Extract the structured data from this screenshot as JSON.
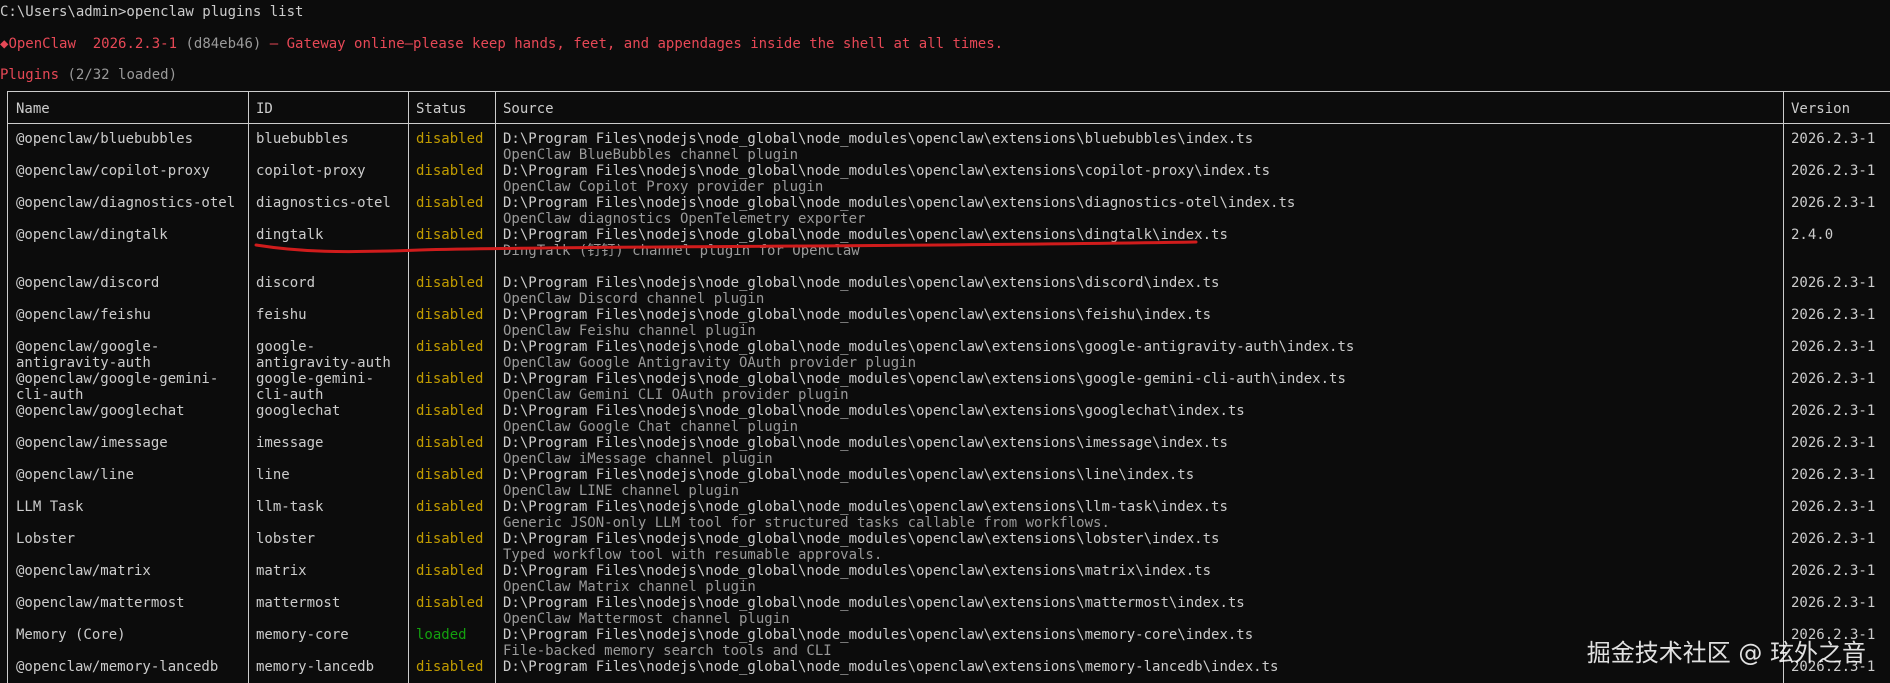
{
  "prompt": "C:\\Users\\admin>openclaw plugins list",
  "banner": {
    "icon": "◆",
    "name": "OpenClaw",
    "version": "2026.2.3-1",
    "hash": "(d84eb46)",
    "message": " — Gateway online—please keep hands, feet, and appendages inside the shell at all times."
  },
  "plugins_title": "Plugins",
  "plugins_count": "(2/32 loaded)",
  "columns": {
    "name": "Name",
    "id": "ID",
    "status": "Status",
    "source": "Source",
    "version": "Version"
  },
  "rows": [
    {
      "name": [
        "@openclaw/bluebubbles"
      ],
      "id": [
        "bluebubbles"
      ],
      "status": "disabled",
      "source": "D:\\Program Files\\nodejs\\node_global\\node_modules\\openclaw\\extensions\\bluebubbles\\index.ts",
      "desc": "OpenClaw BlueBubbles channel plugin",
      "version": "2026.2.3-1"
    },
    {
      "name": [
        "@openclaw/copilot-proxy"
      ],
      "id": [
        "copilot-proxy"
      ],
      "status": "disabled",
      "source": "D:\\Program Files\\nodejs\\node_global\\node_modules\\openclaw\\extensions\\copilot-proxy\\index.ts",
      "desc": "OpenClaw Copilot Proxy provider plugin",
      "version": "2026.2.3-1"
    },
    {
      "name": [
        "@openclaw/diagnostics-otel"
      ],
      "id": [
        "diagnostics-otel"
      ],
      "status": "disabled",
      "source": "D:\\Program Files\\nodejs\\node_global\\node_modules\\openclaw\\extensions\\diagnostics-otel\\index.ts",
      "desc": "OpenClaw diagnostics OpenTelemetry exporter",
      "version": "2026.2.3-1"
    },
    {
      "name": [
        "@openclaw/dingtalk"
      ],
      "id": [
        "dingtalk"
      ],
      "status": "disabled",
      "source": "D:\\Program Files\\nodejs\\node_global\\node_modules\\openclaw\\extensions\\dingtalk\\index.ts",
      "desc": "DingTalk (钉钉) channel plugin for OpenClaw",
      "version": "2.4.0"
    },
    {
      "name": [
        "@openclaw/discord"
      ],
      "id": [
        "discord"
      ],
      "status": "disabled",
      "source": "D:\\Program Files\\nodejs\\node_global\\node_modules\\openclaw\\extensions\\discord\\index.ts",
      "desc": "OpenClaw Discord channel plugin",
      "version": "2026.2.3-1"
    },
    {
      "name": [
        "@openclaw/feishu"
      ],
      "id": [
        "feishu"
      ],
      "status": "disabled",
      "source": "D:\\Program Files\\nodejs\\node_global\\node_modules\\openclaw\\extensions\\feishu\\index.ts",
      "desc": "OpenClaw Feishu channel plugin",
      "version": "2026.2.3-1"
    },
    {
      "name": [
        "@openclaw/google-",
        "antigravity-auth"
      ],
      "id": [
        "google-",
        "antigravity-auth"
      ],
      "status": "disabled",
      "source": "D:\\Program Files\\nodejs\\node_global\\node_modules\\openclaw\\extensions\\google-antigravity-auth\\index.ts",
      "desc": "OpenClaw Google Antigravity OAuth provider plugin",
      "version": "2026.2.3-1"
    },
    {
      "name": [
        "@openclaw/google-gemini-",
        "cli-auth"
      ],
      "id": [
        "google-gemini-",
        "cli-auth"
      ],
      "status": "disabled",
      "source": "D:\\Program Files\\nodejs\\node_global\\node_modules\\openclaw\\extensions\\google-gemini-cli-auth\\index.ts",
      "desc": "OpenClaw Gemini CLI OAuth provider plugin",
      "version": "2026.2.3-1"
    },
    {
      "name": [
        "@openclaw/googlechat"
      ],
      "id": [
        "googlechat"
      ],
      "status": "disabled",
      "source": "D:\\Program Files\\nodejs\\node_global\\node_modules\\openclaw\\extensions\\googlechat\\index.ts",
      "desc": "OpenClaw Google Chat channel plugin",
      "version": "2026.2.3-1"
    },
    {
      "name": [
        "@openclaw/imessage"
      ],
      "id": [
        "imessage"
      ],
      "status": "disabled",
      "source": "D:\\Program Files\\nodejs\\node_global\\node_modules\\openclaw\\extensions\\imessage\\index.ts",
      "desc": "OpenClaw iMessage channel plugin",
      "version": "2026.2.3-1"
    },
    {
      "name": [
        "@openclaw/line"
      ],
      "id": [
        "line"
      ],
      "status": "disabled",
      "source": "D:\\Program Files\\nodejs\\node_global\\node_modules\\openclaw\\extensions\\line\\index.ts",
      "desc": "OpenClaw LINE channel plugin",
      "version": "2026.2.3-1"
    },
    {
      "name": [
        "LLM Task"
      ],
      "id": [
        "llm-task"
      ],
      "status": "disabled",
      "source": "D:\\Program Files\\nodejs\\node_global\\node_modules\\openclaw\\extensions\\llm-task\\index.ts",
      "desc": "Generic JSON-only LLM tool for structured tasks callable from workflows.",
      "version": "2026.2.3-1"
    },
    {
      "name": [
        "Lobster"
      ],
      "id": [
        "lobster"
      ],
      "status": "disabled",
      "source": "D:\\Program Files\\nodejs\\node_global\\node_modules\\openclaw\\extensions\\lobster\\index.ts",
      "desc": "Typed workflow tool with resumable approvals.",
      "version": "2026.2.3-1"
    },
    {
      "name": [
        "@openclaw/matrix"
      ],
      "id": [
        "matrix"
      ],
      "status": "disabled",
      "source": "D:\\Program Files\\nodejs\\node_global\\node_modules\\openclaw\\extensions\\matrix\\index.ts",
      "desc": "OpenClaw Matrix channel plugin",
      "version": "2026.2.3-1"
    },
    {
      "name": [
        "@openclaw/mattermost"
      ],
      "id": [
        "mattermost"
      ],
      "status": "disabled",
      "source": "D:\\Program Files\\nodejs\\node_global\\node_modules\\openclaw\\extensions\\mattermost\\index.ts",
      "desc": "OpenClaw Mattermost channel plugin",
      "version": "2026.2.3-1"
    },
    {
      "name": [
        "Memory (Core)"
      ],
      "id": [
        "memory-core"
      ],
      "status": "loaded",
      "source": "D:\\Program Files\\nodejs\\node_global\\node_modules\\openclaw\\extensions\\memory-core\\index.ts",
      "desc": "File-backed memory search tools and CLI",
      "version": "2026.2.3-1"
    },
    {
      "name": [
        "@openclaw/memory-lancedb"
      ],
      "id": [
        "memory-lancedb"
      ],
      "status": "disabled",
      "source": "D:\\Program Files\\nodejs\\node_global\\node_modules\\openclaw\\extensions\\memory-lancedb\\index.ts",
      "desc": "",
      "version": "2026.2.3-1"
    }
  ],
  "watermark": "掘金技术社区 @ 玹外之音",
  "colors": {
    "background": "#0c0c0c",
    "text": "#cccccc",
    "banner": "#e74856",
    "disabled": "#c19c00",
    "loaded": "#13a10e",
    "annotation": "#d01c1c"
  }
}
